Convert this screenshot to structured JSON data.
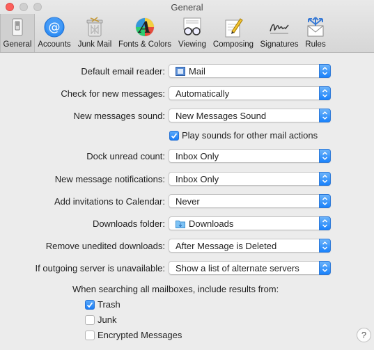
{
  "window": {
    "title": "General"
  },
  "toolbar": {
    "tabs": [
      {
        "label": "General",
        "icon": "general-switch-icon",
        "active": true
      },
      {
        "label": "Accounts",
        "icon": "at-sign-icon"
      },
      {
        "label": "Junk Mail",
        "icon": "trash-can-icon"
      },
      {
        "label": "Fonts & Colors",
        "icon": "font-palette-icon"
      },
      {
        "label": "Viewing",
        "icon": "glasses-icon"
      },
      {
        "label": "Composing",
        "icon": "pencil-paper-icon"
      },
      {
        "label": "Signatures",
        "icon": "signature-icon"
      },
      {
        "label": "Rules",
        "icon": "envelope-arrows-icon"
      }
    ]
  },
  "settings": {
    "default_reader": {
      "label": "Default email reader:",
      "value": "Mail",
      "icon": "mail-stamp-icon"
    },
    "check_messages": {
      "label": "Check for new messages:",
      "value": "Automatically"
    },
    "new_sound": {
      "label": "New messages sound:",
      "value": "New Messages Sound"
    },
    "play_sounds": {
      "label": "Play sounds for other mail actions",
      "checked": true
    },
    "dock_count": {
      "label": "Dock unread count:",
      "value": "Inbox Only"
    },
    "notifications": {
      "label": "New message notifications:",
      "value": "Inbox Only"
    },
    "invitations": {
      "label": "Add invitations to Calendar:",
      "value": "Never"
    },
    "downloads_folder": {
      "label": "Downloads folder:",
      "value": "Downloads",
      "icon": "folder-icon"
    },
    "remove_downloads": {
      "label": "Remove unedited downloads:",
      "value": "After Message is Deleted"
    },
    "outgoing_server": {
      "label": "If outgoing server is unavailable:",
      "value": "Show a list of alternate servers"
    }
  },
  "search": {
    "heading": "When searching all mailboxes, include results from:",
    "options": [
      {
        "label": "Trash",
        "checked": true
      },
      {
        "label": "Junk",
        "checked": false
      },
      {
        "label": "Encrypted Messages",
        "checked": false
      }
    ]
  },
  "help": {
    "label": "?"
  },
  "colors": {
    "accent": "#1a82fb",
    "close": "#fc605c",
    "background": "#ececec"
  }
}
